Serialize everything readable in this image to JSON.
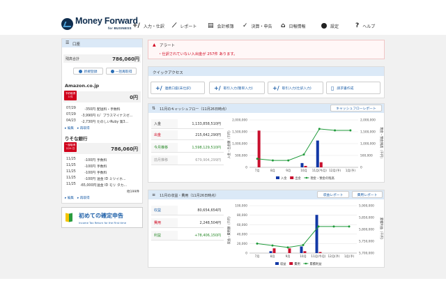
{
  "brand": {
    "name": "Money Forward",
    "sub": "for BUSINESS"
  },
  "nav": [
    {
      "name": "nav-input",
      "icon": "plus-slash-icon",
      "label": "入力・仕訳"
    },
    {
      "name": "nav-report",
      "icon": "line-chart-icon",
      "label": "レポート"
    },
    {
      "name": "nav-books",
      "icon": "book-icon",
      "label": "会計帳簿"
    },
    {
      "name": "nav-closing",
      "icon": "check-icon",
      "label": "決算・申告"
    },
    {
      "name": "nav-dailyinfo",
      "icon": "home-icon",
      "label": "日報情報"
    },
    {
      "name": "nav-settings",
      "icon": "gear-icon",
      "label": "設定"
    },
    {
      "name": "nav-help",
      "icon": "question-icon",
      "label": "ヘルプ"
    }
  ],
  "sidebar": {
    "title": "口座",
    "total_label": "残高合計",
    "total_value": "786,060円",
    "btn_new": "新規登録",
    "btn_update": "一括再取得",
    "accounts": [
      {
        "name": "Amazon.co.jp",
        "badge": "",
        "value": "0円",
        "rows": [
          {
            "date": "07/29",
            "amt": "-350円",
            "desc": "配送料・手数料"
          },
          {
            "date": "07/29",
            "amt": "-3,990円",
            "desc": "ﾈｼﾞ プラスマイナスゼ..."
          },
          {
            "date": "04/23",
            "amt": "-2,730円",
            "desc": "たのしいRuby 第3..."
          }
        ],
        "links": [
          "編集",
          "再取得"
        ]
      },
      {
        "name": "りそな銀行",
        "badge": "一部取得\n2/24 日",
        "value": "786,060円",
        "rows": [
          {
            "date": "11/25",
            "amt": "-100円",
            "desc": "手数料"
          },
          {
            "date": "11/25",
            "amt": "-100円",
            "desc": "手数料"
          },
          {
            "date": "11/25",
            "amt": "-100円",
            "desc": "手数料"
          },
          {
            "date": "11/25",
            "amt": "-100円",
            "desc": "送金 ID ミツイホ..."
          },
          {
            "date": "11/25",
            "amt": "-65,000円",
            "desc": "送金 ID モリ タカ..."
          }
        ],
        "more": "他199件",
        "links": [
          "編集",
          "再取得"
        ]
      }
    ],
    "banner_title": "初めての確定申告",
    "banner_sub": "Income Tax Return for the First time"
  },
  "alert": {
    "title": "アラート",
    "message": "仕訳されていない入出金が 257件 あります。"
  },
  "quick": {
    "title": "クイックアクセス",
    "items": [
      {
        "name": "quick-sync",
        "label": "連携口座(未仕訳)"
      },
      {
        "name": "quick-simple",
        "label": "取引入力(簡単入力)"
      },
      {
        "name": "quick-detail",
        "label": "取引入力(仕訳入力)"
      },
      {
        "name": "quick-invoice",
        "label": "請求書作成"
      }
    ]
  },
  "cashflow": {
    "title": "11月のキャッシュフロー（11月26日時点）",
    "report_btn": "キャッシュフローレポート",
    "rows": [
      {
        "k": "入金",
        "v": "1,133,858,510円",
        "cls": ""
      },
      {
        "k": "出金",
        "v": "215,642,290円",
        "cls": "red"
      },
      {
        "k": "今月推移",
        "v": "1,598,129,510円",
        "cls": "green"
      },
      {
        "k": "前月推移",
        "v": "679,904,299円",
        "cls": "gray"
      }
    ]
  },
  "pl": {
    "title": "11月の収益・費用（11月26日時点）",
    "btn1": "収益レポート",
    "btn2": "費用レポート",
    "rows": [
      {
        "k": "収益",
        "v": "80,654,654円",
        "cls": ""
      },
      {
        "k": "費用",
        "v": "2,248,504円",
        "cls": "red"
      },
      {
        "k": "利益",
        "v": "+78,406,150円",
        "cls": "green"
      }
    ]
  },
  "chart_data": [
    {
      "type": "bar",
      "categories": [
        "7月",
        "8月",
        "9月",
        "10月",
        "11月(今月)",
        "12月(予)",
        "1月(予)"
      ],
      "ylabel": "入金・出金額（千円）",
      "y2label": "現金・預金残高（千円）",
      "ylim": [
        0,
        2000000
      ],
      "y2lim": [
        0,
        2000000
      ],
      "yticks": [
        "0",
        "500,000",
        "1,000,000",
        "1,500,000",
        "2,000,000"
      ],
      "y2ticks": [
        "0",
        "500,000",
        "1,000,000",
        "1,500,000",
        "2,000,000"
      ],
      "series": [
        {
          "name": "入金",
          "color": "#1238a6",
          "values": [
            0,
            0,
            0,
            180000,
            1130000,
            0,
            0
          ]
        },
        {
          "name": "出金",
          "color": "#c8102e",
          "values": [
            1550000,
            0,
            0,
            60000,
            215000,
            0,
            0
          ]
        },
        {
          "name": "現金・預金の残高",
          "color": "#1f9a3a",
          "values": [
            360000,
            290000,
            290000,
            540000,
            1620000,
            1560000,
            1560000
          ]
        }
      ],
      "legend": "bottom"
    },
    {
      "type": "bar",
      "categories": [
        "7月",
        "8月",
        "9月",
        "10月",
        "11月(今月)",
        "12月(予)",
        "1月(予)"
      ],
      "ylabel": "収益・費用額（千円）",
      "y2label": "累積利益（千円）",
      "ylim": [
        0,
        100000
      ],
      "y2lim": [
        5700000,
        5900000
      ],
      "yticks": [
        "0",
        "20,000",
        "40,000",
        "60,000",
        "80,000",
        "100,000"
      ],
      "y2ticks": [
        "5,700,000",
        "5,750,000",
        "5,800,000",
        "5,850,000",
        "5,900,000"
      ],
      "series": [
        {
          "name": "収益",
          "color": "#1238a6",
          "values": [
            0,
            4000,
            0,
            14000,
            80600,
            0,
            0
          ]
        },
        {
          "name": "費用",
          "color": "#c8102e",
          "values": [
            0,
            10000,
            10000,
            4000,
            2250,
            0,
            0
          ]
        },
        {
          "name": "累積利益",
          "color": "#1f9a3a",
          "values": [
            5740000,
            5732000,
            5724000,
            5734000,
            5812000,
            5812000,
            5812000
          ]
        }
      ],
      "legend": "bottom"
    }
  ]
}
